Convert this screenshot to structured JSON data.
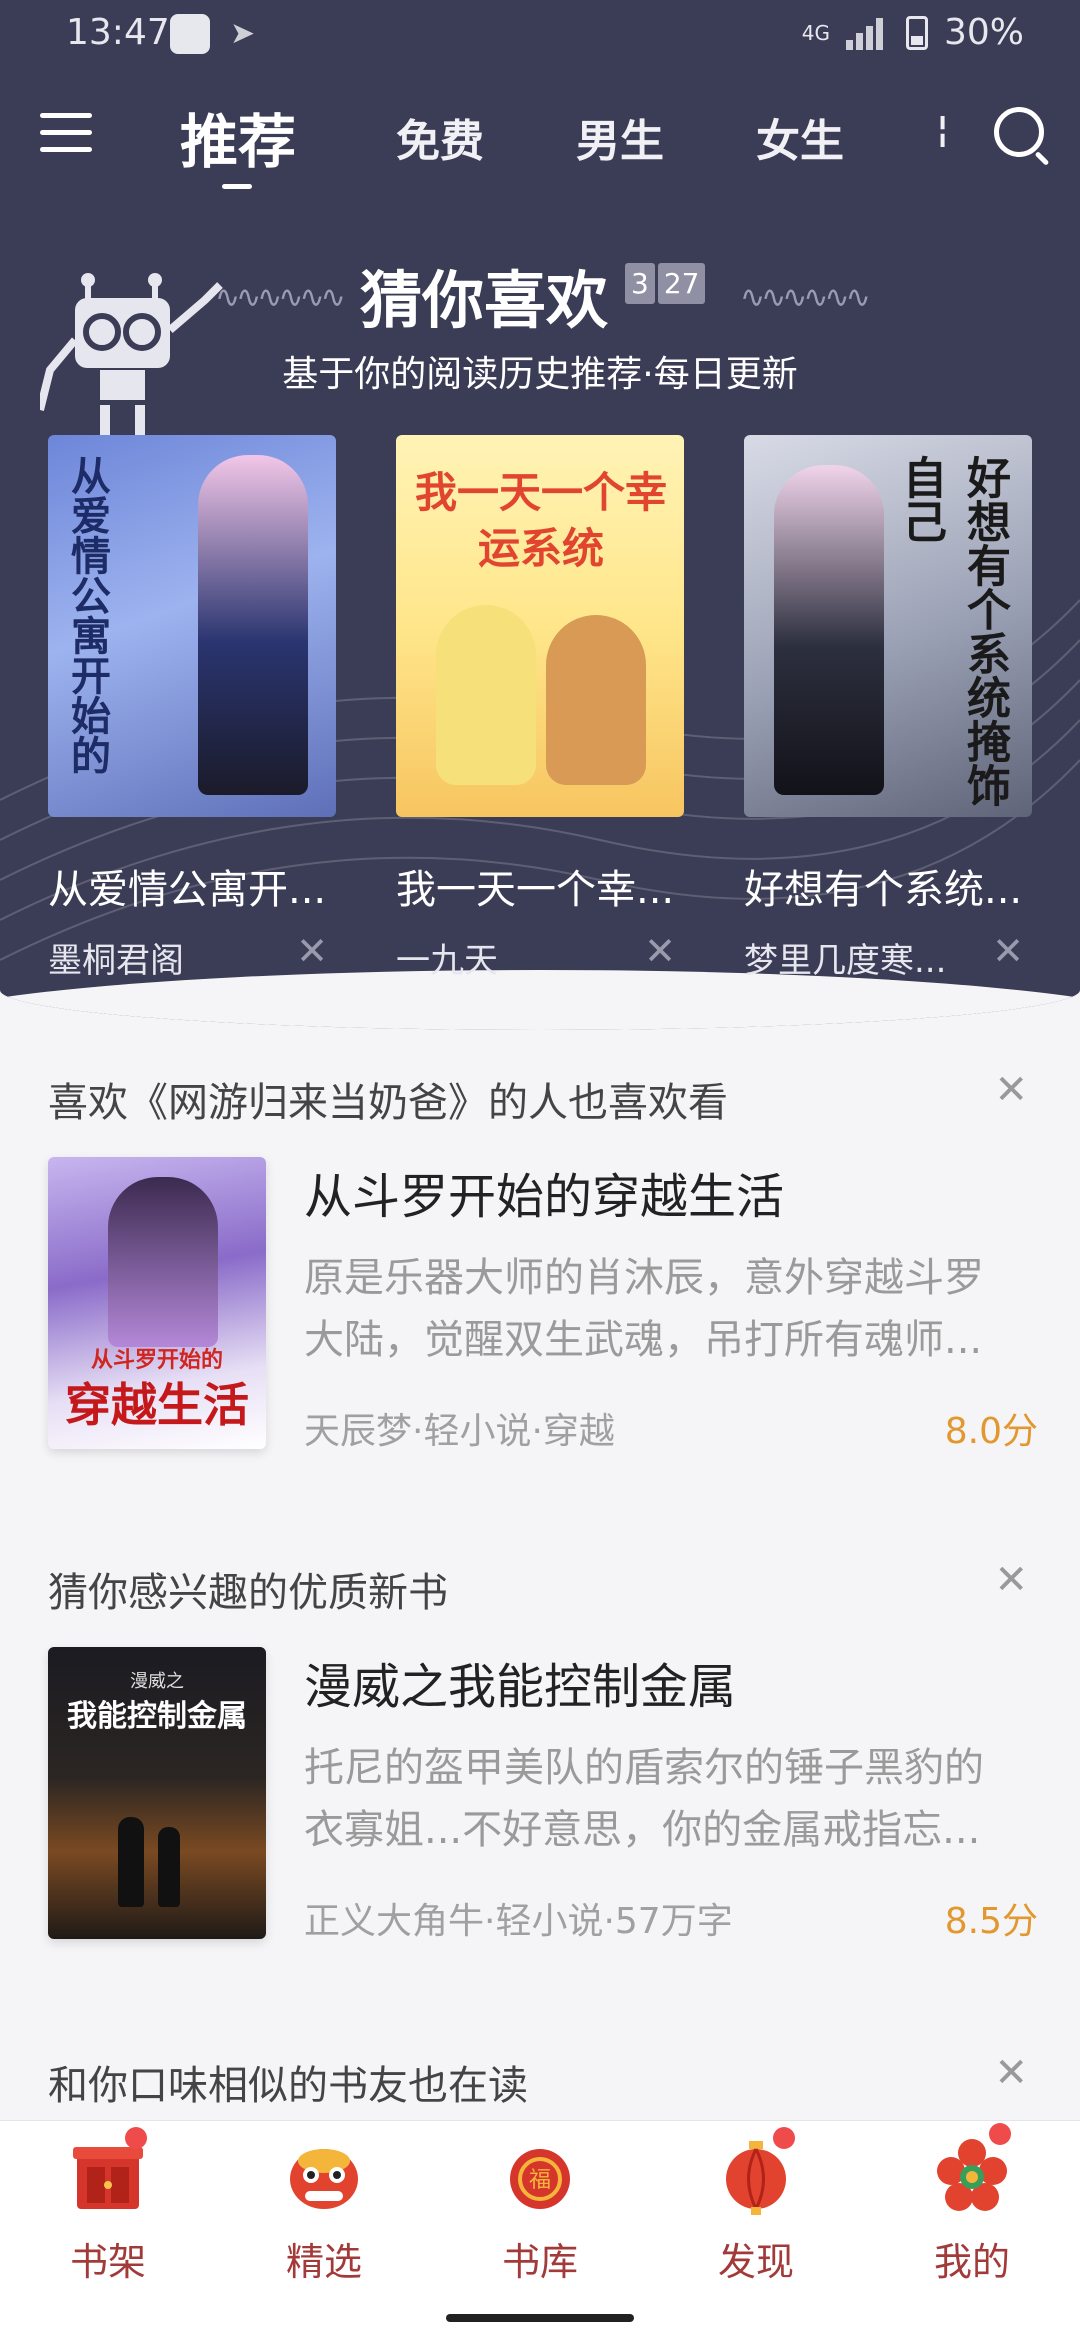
{
  "status_bar": {
    "time": "13:47",
    "network": "4G",
    "battery": "30%"
  },
  "top_nav": {
    "tabs": [
      "推荐",
      "免费",
      "男生",
      "女生"
    ],
    "active_tab": "推荐"
  },
  "guess": {
    "title": "猜你喜欢",
    "date_month": "3",
    "date_day": "27",
    "subtitle": "基于你的阅读历史推荐·每日更新",
    "books": [
      {
        "title": "从爱情公寓开...",
        "author": "墨桐君阁",
        "cover_text": "从爱情公寓开始的"
      },
      {
        "title": "我一天一个幸...",
        "author": "一九天",
        "cover_text": "我一天一个幸运系统"
      },
      {
        "title": "好想有个系统...",
        "author": "梦里几度寒...",
        "cover_text": "好想有个系统掩饰自己"
      }
    ]
  },
  "sections": [
    {
      "header": "喜欢《网游归来当奶爸》的人也喜欢看",
      "book": {
        "title": "从斗罗开始的穿越生活",
        "desc_line1": "原是乐器大师的肖沐辰，意外穿越斗罗",
        "desc_line2": "大陆，觉醒双生武魂，吊打所有魂师...",
        "meta": "天辰梦·轻小说·穿越",
        "score": "8.0分",
        "cover_text": "穿越生活",
        "cover_subtext": "从斗罗开始的"
      }
    },
    {
      "header": "猜你感兴趣的优质新书",
      "book": {
        "title": "漫威之我能控制金属",
        "desc_line1": "托尼的盔甲美队的盾索尔的锤子黑豹的",
        "desc_line2": "衣寡姐...不好意思，你的金属戒指忘...",
        "meta": "正义大角牛·轻小说·57万字",
        "score": "8.5分",
        "cover_text": "我能控制金属",
        "cover_subtext": "漫威之"
      }
    },
    {
      "header": "和你口味相似的书友也在读"
    }
  ],
  "bottom_nav": {
    "items": [
      {
        "label": "书架",
        "icon": "bookshelf-icon",
        "dot": true
      },
      {
        "label": "精选",
        "icon": "lion-dance-icon",
        "dot": false
      },
      {
        "label": "书库",
        "icon": "library-lantern-icon",
        "dot": false
      },
      {
        "label": "发现",
        "icon": "discover-lantern-icon",
        "dot": true
      },
      {
        "label": "我的",
        "icon": "profile-flower-icon",
        "dot": true
      }
    ]
  },
  "colors": {
    "hero_bg": "#3b3c55",
    "score": "#e2972f",
    "nav_label": "#a33a3a"
  }
}
